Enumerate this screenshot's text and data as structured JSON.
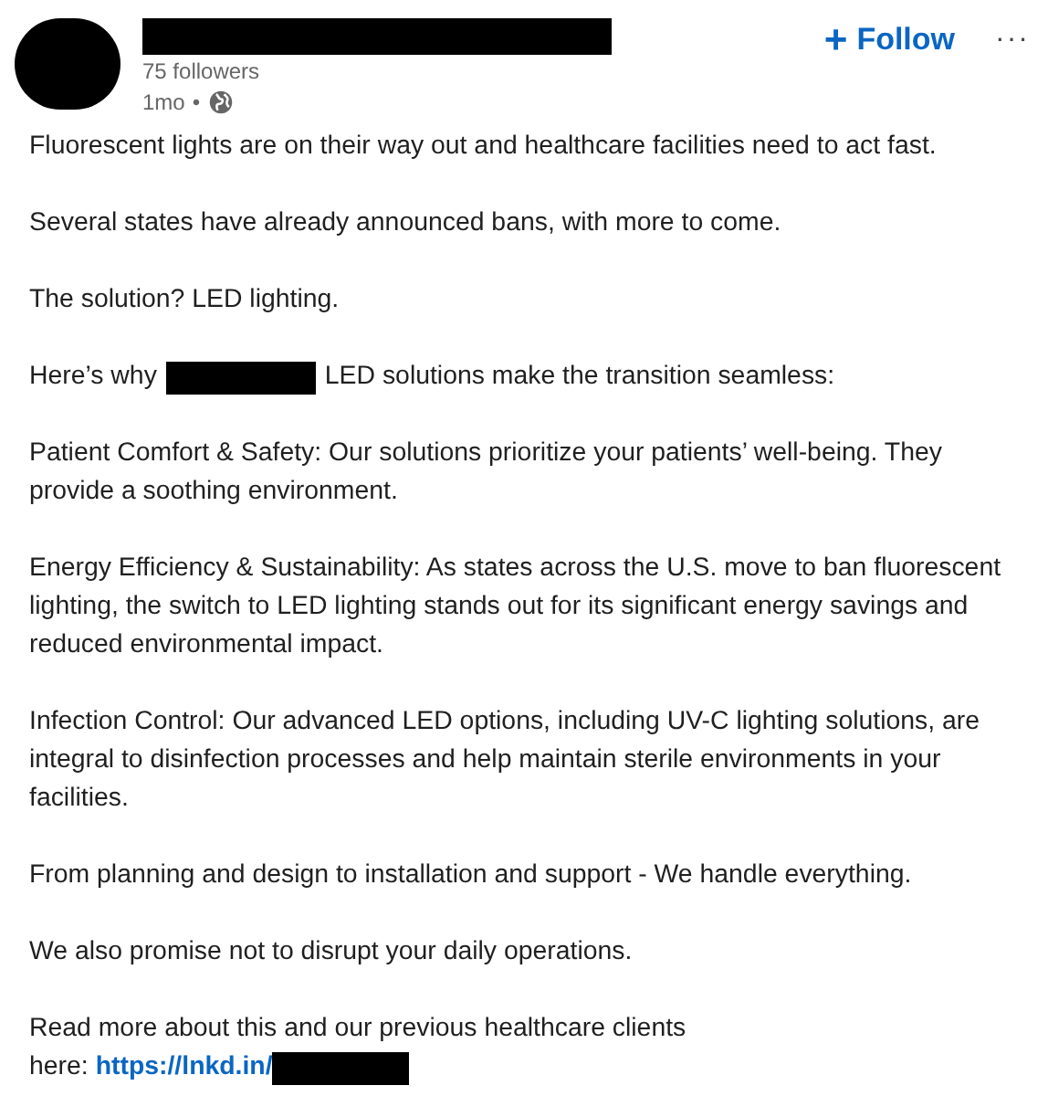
{
  "author": {
    "followers": "75 followers",
    "time": "1mo",
    "separator": "•"
  },
  "follow_button": {
    "icon": "+",
    "label": "Follow"
  },
  "more_button": {
    "label": "···"
  },
  "paragraphs": [
    {
      "kind": "text",
      "text": "Fluorescent lights are on their way out and healthcare facilities need to act fast."
    },
    {
      "kind": "text",
      "text": "Several states have already announced bans, with more to come."
    },
    {
      "kind": "text",
      "text": "The solution? LED lighting."
    },
    {
      "kind": "redacted",
      "before": "Here’s why",
      "after": "LED solutions make the transition seamless:"
    },
    {
      "kind": "text",
      "text": "Patient Comfort & Safety: Our solutions prioritize your patients’ well-being. They provide a soothing environment."
    },
    {
      "kind": "text",
      "text": "Energy Efficiency & Sustainability: As states across the U.S. move to ban fluorescent lighting, the switch to LED lighting stands out for its significant energy savings and reduced environmental impact."
    },
    {
      "kind": "text",
      "text": "Infection Control: Our advanced LED options, including UV-C lighting solutions, are integral to disinfection processes and help maintain sterile environments in your facilities."
    },
    {
      "kind": "text",
      "text": "From planning and design to installation and support - We handle everything."
    },
    {
      "kind": "text",
      "text": "We also promise not to disrupt your daily operations."
    },
    {
      "kind": "link",
      "text": "Read more about this and our previous healthcare clients",
      "before": "here:",
      "link": "https://lnkd.in/"
    }
  ]
}
